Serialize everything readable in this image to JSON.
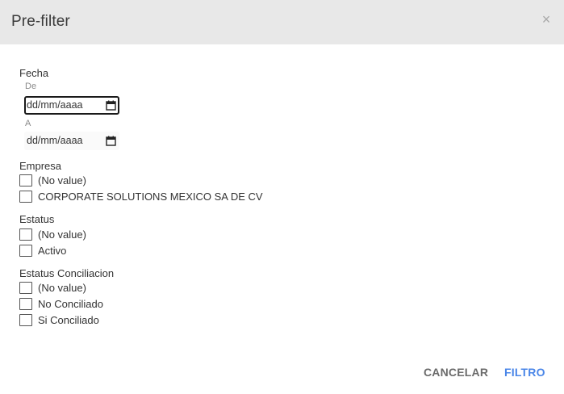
{
  "dialog": {
    "title": "Pre-filter",
    "close_glyph": "×"
  },
  "fecha": {
    "label": "Fecha",
    "from_label": "De",
    "from_value": "dd/mm/aaaa",
    "to_label": "A",
    "to_value": "dd/mm/aaaa"
  },
  "empresa": {
    "label": "Empresa",
    "options": [
      {
        "label": "(No value)",
        "checked": false
      },
      {
        "label": "CORPORATE SOLUTIONS MEXICO SA DE CV",
        "checked": false
      }
    ]
  },
  "estatus": {
    "label": "Estatus",
    "options": [
      {
        "label": "(No value)",
        "checked": false
      },
      {
        "label": "Activo",
        "checked": false
      }
    ]
  },
  "estatus_conciliacion": {
    "label": "Estatus Conciliacion",
    "options": [
      {
        "label": "(No value)",
        "checked": false
      },
      {
        "label": "No Conciliado",
        "checked": false
      },
      {
        "label": "Si Conciliado",
        "checked": false
      }
    ]
  },
  "footer": {
    "cancel_label": "CANCELAR",
    "filter_label": "FILTRO"
  },
  "colors": {
    "header_bg": "#e8e8e8",
    "primary_button": "#4a86e8",
    "secondary_button": "#6b6b6b"
  },
  "icons": {
    "close": "close-icon",
    "calendar": "calendar-icon"
  }
}
